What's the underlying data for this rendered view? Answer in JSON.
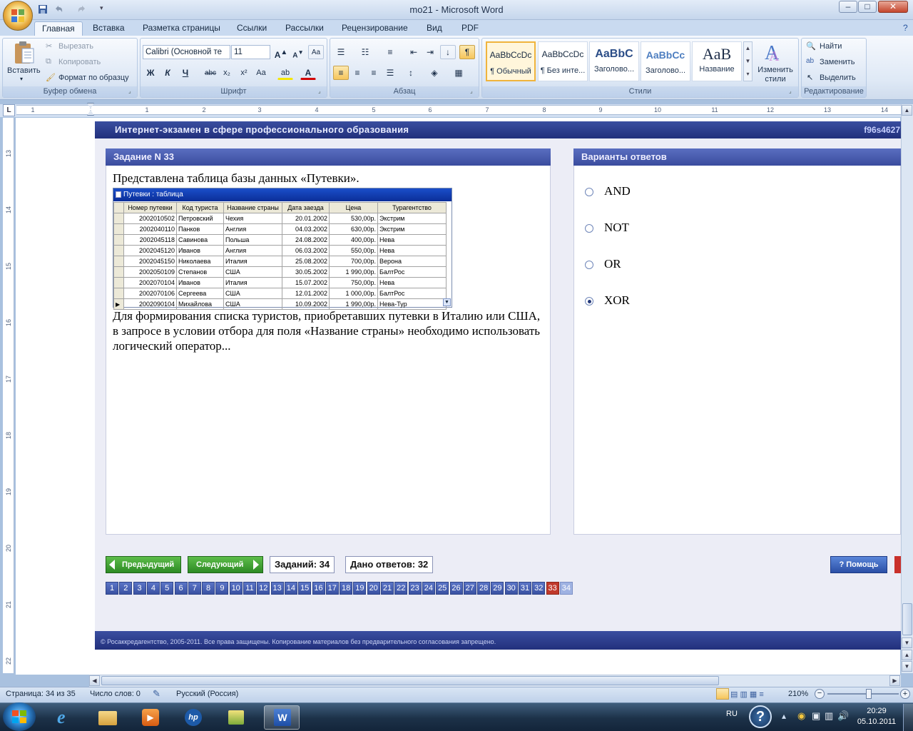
{
  "window": {
    "title": "mo21 - Microsoft Word",
    "min": "–",
    "max": "□",
    "close": "✕"
  },
  "tabs": [
    "Главная",
    "Вставка",
    "Разметка страницы",
    "Ссылки",
    "Рассылки",
    "Рецензирование",
    "Вид",
    "PDF"
  ],
  "clipboard": {
    "paste": "Вставить",
    "cut": "Вырезать",
    "copy": "Копировать",
    "format_painter": "Формат по образцу",
    "label": "Буфер обмена"
  },
  "font": {
    "name": "Calibri (Основной те",
    "size": "11",
    "label": "Шрифт",
    "bold": "Ж",
    "italic": "К",
    "underline": "Ч",
    "strike": "abc",
    "sub": "x₂",
    "sup": "x²",
    "case": "Aa"
  },
  "paragraph": {
    "label": "Абзац",
    "pilcrow": "¶"
  },
  "styles": {
    "label": "Стили",
    "items": [
      {
        "preview": "AaBbCcDc",
        "name": "¶ Обычный"
      },
      {
        "preview": "AaBbCcDc",
        "name": "¶ Без инте..."
      },
      {
        "preview": "AaBbC",
        "name": "Заголово..."
      },
      {
        "preview": "AaBbCc",
        "name": "Заголово..."
      },
      {
        "preview": "AaB",
        "name": "Название"
      }
    ],
    "change": "Изменить стили"
  },
  "editing": {
    "find": "Найти",
    "replace": "Заменить",
    "select": "Выделить",
    "label": "Редактирование"
  },
  "ruler": {
    "h": [
      "1",
      "1",
      "2",
      "3",
      "4",
      "5",
      "6",
      "7",
      "8",
      "9",
      "10",
      "11",
      "12",
      "13",
      "14"
    ],
    "v": [
      "13",
      "14",
      "15",
      "16",
      "17",
      "18",
      "19",
      "20",
      "21",
      "22"
    ]
  },
  "exam": {
    "header": "Интернет-экзамен в сфере профессионального образования",
    "code": "f96s4627",
    "task_title": "Задание N 33",
    "intro": "Представлена таблица базы данных «Путевки».",
    "question": "Для формирования списка туристов, приобретавших путевки в Италию или США, в запросе в условии отбора  для поля «Название страны» необходимо использовать логический оператор...",
    "table": {
      "title": "Путевки : таблица",
      "columns": [
        "Номер путевки",
        "Код туриста",
        "Название страны",
        "Дата заезда",
        "Цена",
        "Турагентство"
      ],
      "rows": [
        [
          "2002010502",
          "Петровский",
          "Чехия",
          "20.01.2002",
          "530,00р.",
          "Экстрим"
        ],
        [
          "2002040110",
          "Панков",
          "Англия",
          "04.03.2002",
          "630,00р.",
          "Экстрим"
        ],
        [
          "2002045118",
          "Савинова",
          "Польша",
          "24.08.2002",
          "400,00р.",
          "Нева"
        ],
        [
          "2002045120",
          "Иванов",
          "Англия",
          "06.03.2002",
          "550,00р.",
          "Нева"
        ],
        [
          "2002045150",
          "Николаева",
          "Италия",
          "25.08.2002",
          "700,00р.",
          "Верона"
        ],
        [
          "2002050109",
          "Степанов",
          "США",
          "30.05.2002",
          "1 990,00р.",
          "БалтРос"
        ],
        [
          "2002070104",
          "Иванов",
          "Италия",
          "15.07.2002",
          "750,00р.",
          "Нева"
        ],
        [
          "2002070106",
          "Сергеева",
          "США",
          "12.01.2002",
          "1 000,00р.",
          "БалтРос"
        ],
        [
          "2002090104",
          "Михайлова",
          "США",
          "10.09.2002",
          "1 990,00р.",
          "Нева-Тур"
        ]
      ]
    },
    "answers_title": "Варианты ответов",
    "options": [
      {
        "text": "AND",
        "selected": false
      },
      {
        "text": "NOT",
        "selected": false
      },
      {
        "text": "OR",
        "selected": false
      },
      {
        "text": "XOR",
        "selected": true
      }
    ],
    "prev": "Предыдущий",
    "next": "Следующий",
    "tasks_count": "Заданий: 34",
    "answered": "Дано ответов: 32",
    "help": "Помощь",
    "pages": [
      "1",
      "2",
      "3",
      "4",
      "5",
      "6",
      "7",
      "8",
      "9",
      "10",
      "11",
      "12",
      "13",
      "14",
      "15",
      "16",
      "17",
      "18",
      "19",
      "20",
      "21",
      "22",
      "23",
      "24",
      "25",
      "26",
      "27",
      "28",
      "29",
      "30",
      "31",
      "32",
      "33",
      "34"
    ],
    "current_page": "33",
    "footer": "© Росаккредагентство, 2005-2011. Все права защищены. Копирование материалов без предварительного согласования запрещено."
  },
  "status": {
    "page": "Страница: 34 из 35",
    "words": "Число слов: 0",
    "lang": "Русский (Россия)",
    "zoom": "210%"
  },
  "taskbar": {
    "lang": "RU",
    "time": "20:29",
    "date": "05.10.2011"
  }
}
